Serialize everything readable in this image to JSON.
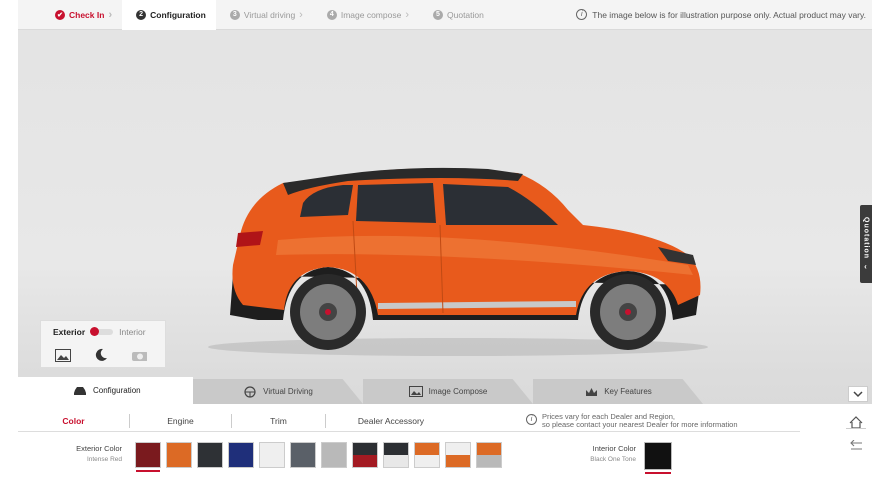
{
  "steps": [
    {
      "num": "✔",
      "label": "Check In",
      "state": "done"
    },
    {
      "num": "2",
      "label": "Configuration",
      "state": "active"
    },
    {
      "num": "3",
      "label": "Virtual driving",
      "state": "todo"
    },
    {
      "num": "4",
      "label": "Image compose",
      "state": "todo"
    },
    {
      "num": "5",
      "label": "Quotation",
      "state": "todo"
    }
  ],
  "notice": "The image below is for illustration purpose only. Actual product may vary.",
  "quotation_tab": "Quotation",
  "view_toggle": {
    "exterior": "Exterior",
    "interior": "Interior",
    "icons": [
      "image-icon",
      "moon-icon",
      "camera-icon"
    ]
  },
  "main_tabs": [
    {
      "label": "Configuration",
      "icon": "car-icon"
    },
    {
      "label": "Virtual Driving",
      "icon": "steering-wheel-icon"
    },
    {
      "label": "Image Compose",
      "icon": "image-icon"
    },
    {
      "label": "Key Features",
      "icon": "crown-icon"
    }
  ],
  "sub_tabs": [
    "Color",
    "Engine",
    "Trim",
    "Dealer Accessory"
  ],
  "price_note": {
    "line1": "Prices vary for each Dealer and Region,",
    "line2": "so please contact your nearest Dealer for more information"
  },
  "exterior_color": {
    "label": "Exterior Color",
    "value": "Intense Red"
  },
  "swatches": [
    {
      "top": "#7a1a1e",
      "bottom": "#7a1a1e",
      "selected": true
    },
    {
      "top": "#dc6a25",
      "bottom": "#dc6a25"
    },
    {
      "top": "#2e3135",
      "bottom": "#2e3135"
    },
    {
      "top": "#1f2f7a",
      "bottom": "#1f2f7a"
    },
    {
      "top": "#efefef",
      "bottom": "#efefef"
    },
    {
      "top": "#5a6068",
      "bottom": "#5a6068"
    },
    {
      "top": "#b9b9b9",
      "bottom": "#b9b9b9"
    },
    {
      "top": "#2c2f33",
      "bottom": "#a31a22"
    },
    {
      "top": "#2c2f33",
      "bottom": "#e8e8e8"
    },
    {
      "top": "#dc6a25",
      "bottom": "#efefef"
    },
    {
      "top": "#efefef",
      "bottom": "#dc6a25"
    },
    {
      "top": "#dc6a25",
      "bottom": "#b9b9b9"
    }
  ],
  "interior_color": {
    "label": "Interior Color",
    "value": "Black One Tone",
    "swatch": "#111111"
  },
  "colors": {
    "accent": "#c8102e",
    "car_body": "#e85a1c"
  }
}
